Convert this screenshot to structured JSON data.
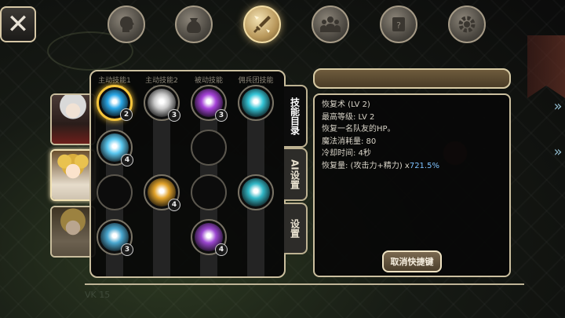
{
  "tabs": [
    {
      "name": "tab-character",
      "icon": "head-icon",
      "active": false
    },
    {
      "name": "tab-inventory",
      "icon": "bag-icon",
      "active": false
    },
    {
      "name": "tab-skills",
      "icon": "sword-icon",
      "active": true
    },
    {
      "name": "tab-party",
      "icon": "group-icon",
      "active": false
    },
    {
      "name": "tab-quests",
      "icon": "scroll-icon",
      "active": false
    },
    {
      "name": "tab-settings",
      "icon": "gear-icon",
      "active": false
    }
  ],
  "close_label": "✕",
  "skill_panel": {
    "columns": [
      "主动技能1",
      "主动技能2",
      "被动技能",
      "佣兵团技能"
    ],
    "skills": [
      {
        "col": 0,
        "row": 0,
        "icon": "heal-hand-icon",
        "level": "2",
        "color": "#2aa7e6",
        "selected": true
      },
      {
        "col": 1,
        "row": 0,
        "icon": "lightning-shield-icon",
        "level": "3",
        "color": "#c9c9c9"
      },
      {
        "col": 2,
        "row": 0,
        "icon": "purple-cross-icon",
        "level": "3",
        "color": "#a542d8"
      },
      {
        "col": 3,
        "row": 0,
        "icon": "cyan-orb-icon",
        "level": "",
        "color": "#35c6d8"
      },
      {
        "col": 0,
        "row": 1,
        "icon": "winged-armor-icon",
        "level": "4",
        "color": "#5ac8f0"
      },
      {
        "col": 2,
        "row": 1,
        "icon": "",
        "level": "",
        "color": ""
      },
      {
        "col": 0,
        "row": 2,
        "icon": "",
        "level": "",
        "color": ""
      },
      {
        "col": 1,
        "row": 2,
        "icon": "golden-hammer-icon",
        "level": "4",
        "color": "#e2a32a"
      },
      {
        "col": 2,
        "row": 2,
        "icon": "",
        "level": "",
        "color": ""
      },
      {
        "col": 3,
        "row": 2,
        "icon": "potion-icon",
        "level": "",
        "color": "#32b8c7"
      },
      {
        "col": 0,
        "row": 3,
        "icon": "armored-helmet-icon",
        "level": "3",
        "color": "#4aa8d0"
      },
      {
        "col": 2,
        "row": 3,
        "icon": "purple-shield-cross-icon",
        "level": "4",
        "color": "#9a46d0"
      }
    ]
  },
  "side_tabs": [
    {
      "label": "技能目录",
      "active": true
    },
    {
      "label": "AI设置",
      "active": false
    },
    {
      "label": "设置",
      "active": false
    }
  ],
  "heroes": [
    {
      "name": "hero-white-hair",
      "active": false
    },
    {
      "name": "hero-blonde-girl",
      "active": true
    },
    {
      "name": "hero-blonde-girl-alt",
      "active": false
    }
  ],
  "detail": {
    "name_bar": "",
    "lines": [
      "恢复术 (LV 2)",
      "最高等级:    LV 2",
      "恢复一名队友的HP。",
      "魔法消耗量: 80",
      "冷却时间: 4秒"
    ],
    "formula_label": "恢复量:    (攻击力+精力) x",
    "formula_value": "721.5%",
    "cancel_button": "取消快捷键"
  },
  "arrows": [
    "»",
    "»"
  ],
  "bottom_text": "VK 15"
}
